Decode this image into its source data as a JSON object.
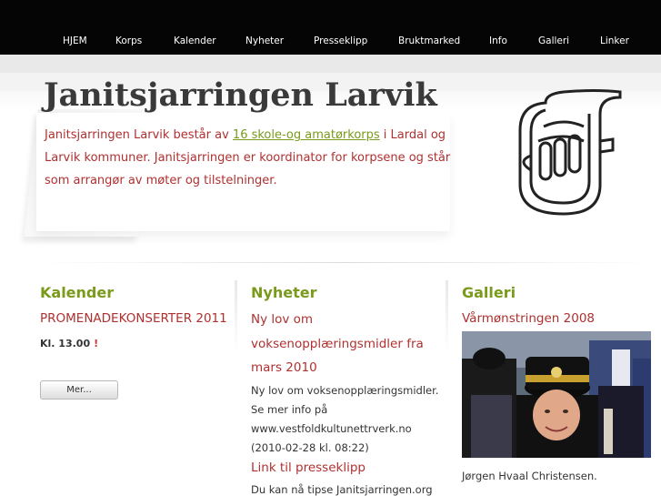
{
  "nav": {
    "items": [
      "HJEM",
      "Korps",
      "Kalender",
      "Nyheter",
      "Presseklipp",
      "Bruktmarked",
      "Info",
      "Galleri",
      "Linker"
    ]
  },
  "header": {
    "title": "Janitsjarringen Larvik",
    "intro_before": "Janitsjarringen Larvik består av ",
    "intro_link": "16 skole-og amatørkorps",
    "intro_after": " i Lardal og Larvik kommuner. Janitsjarringen er koordinator for korpsene og står som arrangør av møter og tilstelninger."
  },
  "calendar": {
    "title": "Kalender",
    "event": "PROMENADEKONSERTER 2011",
    "time": "Kl. 13.00",
    "alert": "!",
    "more_button": "Mer..."
  },
  "news": {
    "title": "Nyheter",
    "headline": "Ny lov om voksenopplæringsmidler fra mars 2010",
    "body": "Ny lov om voksenopplæringsmidler. Se mer info på www.vestfoldkultunettrverk.no (2010-02-28 kl. 08:22)",
    "link2": "Link til presseklipp",
    "body2": "Du kan nå tipse Janitsjarringen.org"
  },
  "gallery": {
    "title": "Galleri",
    "album": "Vårmønstringen 2008",
    "caption": "Jørgen Hvaal Christensen."
  },
  "colors": {
    "accent_green": "#7a9a1a",
    "accent_red": "#b03030",
    "topbar": "#050505"
  }
}
